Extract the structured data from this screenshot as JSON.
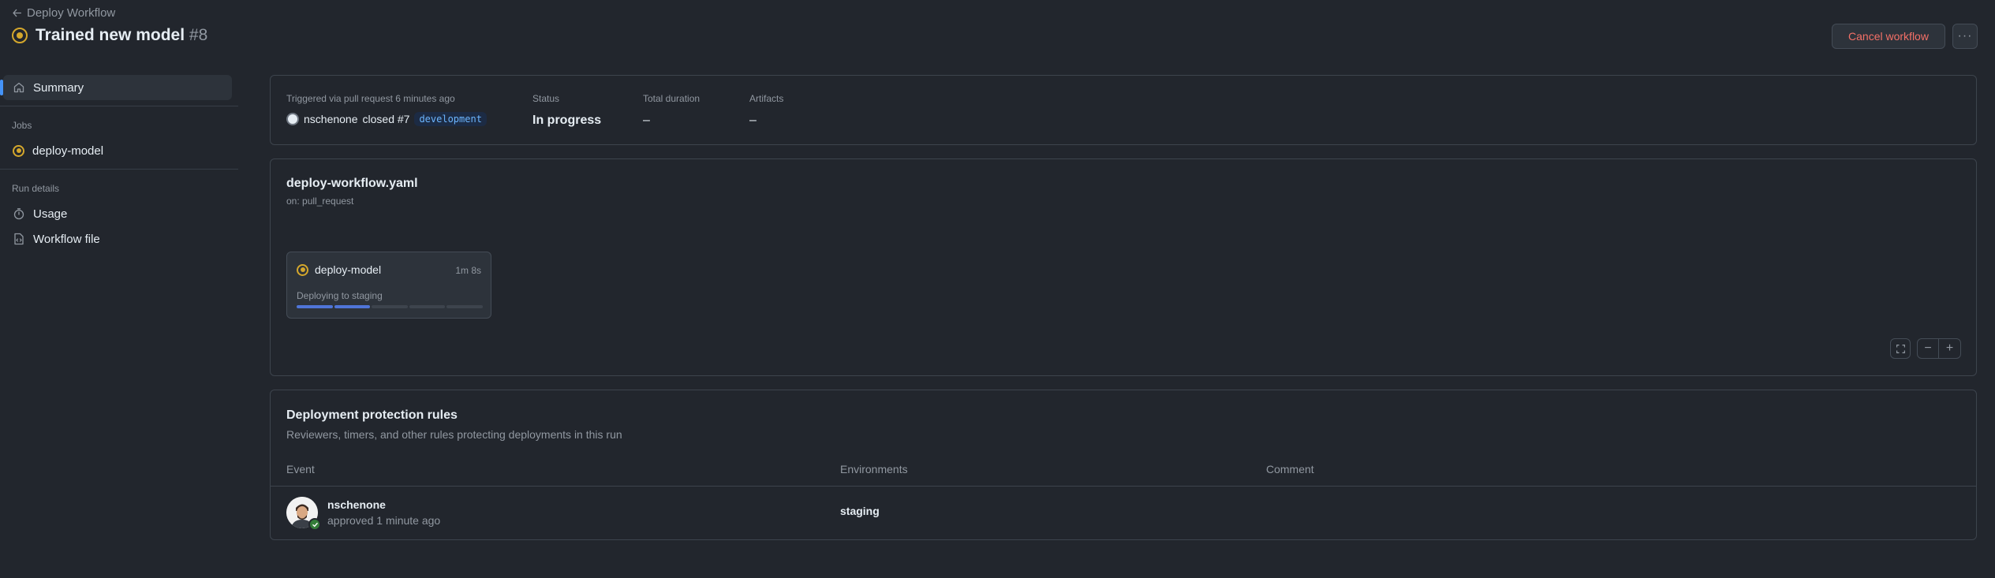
{
  "header": {
    "back_label": "Deploy Workflow",
    "title": "Trained new model",
    "run_number": "#8",
    "cancel_label": "Cancel workflow",
    "more_label": "···"
  },
  "sidebar": {
    "summary_label": "Summary",
    "jobs_heading": "Jobs",
    "job_item": "deploy-model",
    "run_details_heading": "Run details",
    "usage_label": "Usage",
    "workflow_file_label": "Workflow file"
  },
  "summary": {
    "trigger_label": "Triggered via pull request 6 minutes ago",
    "trigger_user": "nschenone",
    "trigger_action": "closed #7",
    "branch": "development",
    "status_label": "Status",
    "status_value": "In progress",
    "duration_label": "Total duration",
    "duration_value": "–",
    "artifacts_label": "Artifacts",
    "artifacts_value": "–"
  },
  "workflow": {
    "file_name": "deploy-workflow.yaml",
    "on": "on: pull_request",
    "job": {
      "name": "deploy-model",
      "time": "1m 8s",
      "status": "Deploying to staging",
      "steps_total": 5,
      "steps_done": 2
    }
  },
  "deployment": {
    "title": "Deployment protection rules",
    "subtitle": "Reviewers, timers, and other rules protecting deployments in this run",
    "columns": [
      "Event",
      "Environments",
      "Comment"
    ],
    "rows": [
      {
        "user": "nschenone",
        "event": "approved 1 minute ago",
        "environment": "staging",
        "comment": ""
      }
    ]
  },
  "colors": {
    "background": "#22262d",
    "accent_blue": "#4493f8",
    "in_progress": "#d4a72c",
    "danger": "#f47067",
    "success": "#347d39"
  }
}
